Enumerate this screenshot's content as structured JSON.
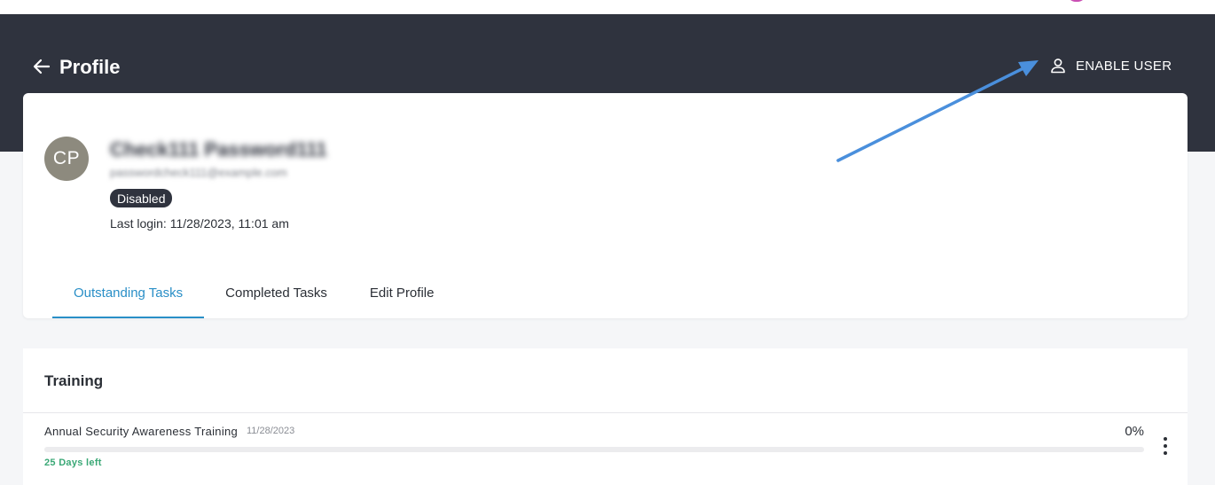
{
  "header": {
    "title": "Profile",
    "enable_user_label": "ENABLE USER"
  },
  "profile": {
    "initials": "CP",
    "name": "Check111 Password111",
    "email": "passwordcheck111@example.com",
    "status": "Disabled",
    "last_login": "Last login: 11/28/2023, 11:01 am"
  },
  "tabs": [
    {
      "label": "Outstanding Tasks",
      "active": true
    },
    {
      "label": "Completed Tasks",
      "active": false
    },
    {
      "label": "Edit Profile",
      "active": false
    }
  ],
  "training": {
    "section_title": "Training",
    "items": [
      {
        "title": "Annual Security Awareness Training",
        "date": "11/28/2023",
        "percent": "0%",
        "progress": 0,
        "days_left": "25 Days left"
      }
    ]
  },
  "colors": {
    "header_bg": "#2f333e",
    "accent": "#2a8fc7",
    "success": "#3aa876",
    "annotation_arrow": "#4a8fdc"
  },
  "icons": {
    "back": "arrow-left-icon",
    "enable_user": "user-icon",
    "row_menu": "more-vertical-icon"
  }
}
